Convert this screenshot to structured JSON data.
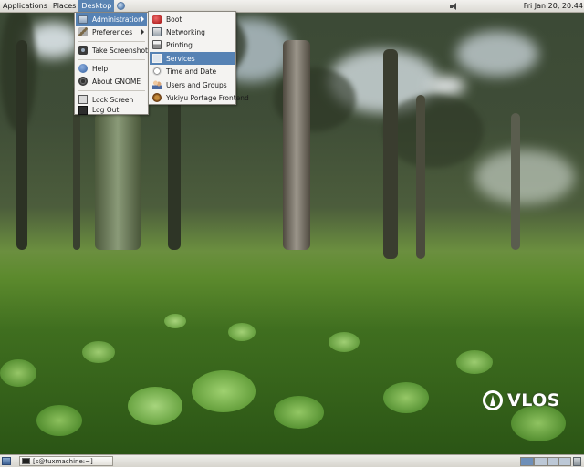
{
  "top_panel": {
    "menus": [
      "Applications",
      "Places",
      "Desktop"
    ],
    "active_menu": "Desktop",
    "clock": "Fri Jan 20, 20:44"
  },
  "desktop_menu": {
    "items": [
      {
        "label": "Administration",
        "icon": "administration-icon",
        "submenu": true,
        "highlighted": true
      },
      {
        "label": "Preferences",
        "icon": "preferences-icon",
        "submenu": true
      },
      {
        "label": "Take Screenshot...",
        "icon": "camera-icon"
      },
      {
        "label": "Help",
        "icon": "help-icon"
      },
      {
        "label": "About GNOME",
        "icon": "gnome-icon"
      },
      {
        "label": "Lock Screen",
        "icon": "lock-icon"
      },
      {
        "label": "Log Out",
        "icon": "logout-icon"
      }
    ]
  },
  "admin_menu": {
    "items": [
      {
        "label": "Boot",
        "icon": "boot-icon"
      },
      {
        "label": "Networking",
        "icon": "network-icon"
      },
      {
        "label": "Printing",
        "icon": "printer-icon"
      },
      {
        "label": "Services",
        "icon": "services-icon",
        "highlighted": true
      },
      {
        "label": "Time and Date",
        "icon": "clock-icon"
      },
      {
        "label": "Users and Groups",
        "icon": "users-icon"
      },
      {
        "label": "Yukiyu Portage Frontend",
        "icon": "yukiyu-icon"
      }
    ]
  },
  "wallpaper": {
    "logo_text": "VLOS"
  },
  "bottom_panel": {
    "task": "[s@tuxmachine:~]",
    "workspaces": 4,
    "active_workspace": 1
  },
  "colors": {
    "highlight": "#5682b4",
    "panel": "#e4e2dc"
  }
}
